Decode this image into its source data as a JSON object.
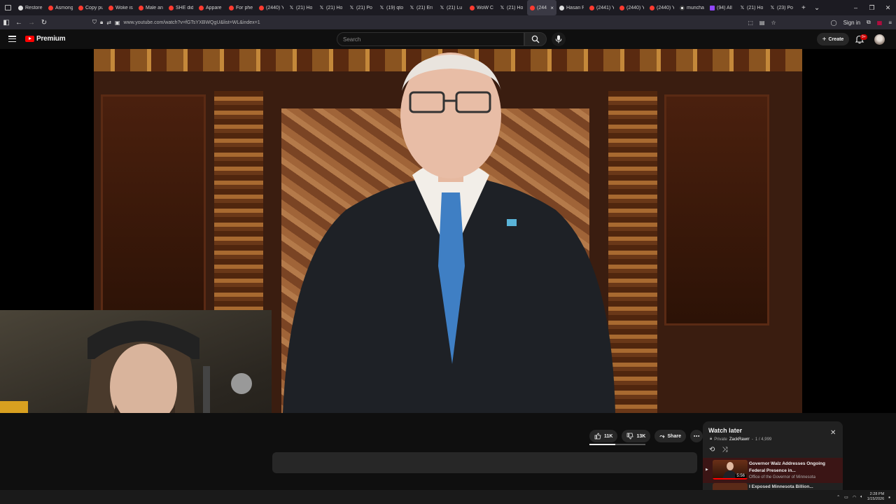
{
  "browser": {
    "tabs": [
      {
        "label": "Restore",
        "icon": "firefox-icon",
        "favicon": "ffx"
      },
      {
        "label": "Asmong",
        "icon": "reddit-icon",
        "favicon": "red"
      },
      {
        "label": "Copy pu",
        "icon": "reddit-icon",
        "favicon": "red"
      },
      {
        "label": "Woke is",
        "icon": "reddit-icon",
        "favicon": "red"
      },
      {
        "label": "Male an",
        "icon": "reddit-icon",
        "favicon": "red"
      },
      {
        "label": "SHE did",
        "icon": "reddit-icon",
        "favicon": "red"
      },
      {
        "label": "Appare",
        "icon": "reddit-icon",
        "favicon": "red"
      },
      {
        "label": "For phe",
        "icon": "reddit-icon",
        "favicon": "red"
      },
      {
        "label": "(2440) Y",
        "icon": "youtube-icon",
        "favicon": "red"
      },
      {
        "label": "(21) Ho",
        "icon": "x-icon",
        "favicon": "x"
      },
      {
        "label": "(21) Ho",
        "icon": "x-icon",
        "favicon": "x"
      },
      {
        "label": "(21) Po",
        "icon": "x-icon",
        "favicon": "x"
      },
      {
        "label": "(19) qto",
        "icon": "x-icon",
        "favicon": "x"
      },
      {
        "label": "(21) Eri",
        "icon": "x-icon",
        "favicon": "x"
      },
      {
        "label": "(21) Lu",
        "icon": "x-icon",
        "favicon": "x"
      },
      {
        "label": "WoW C",
        "icon": "reddit-icon",
        "favicon": "red"
      },
      {
        "label": "(21) Ho",
        "icon": "x-icon",
        "favicon": "x"
      },
      {
        "label": "(244",
        "icon": "youtube-icon",
        "favicon": "red",
        "active": true
      },
      {
        "label": "Hasan P",
        "icon": "site-icon",
        "favicon": "ffx"
      },
      {
        "label": "(2441) Y",
        "icon": "youtube-icon",
        "favicon": "red"
      },
      {
        "label": "(2440) Y",
        "icon": "youtube-icon",
        "favicon": "red"
      },
      {
        "label": "(2440) Y",
        "icon": "youtube-icon",
        "favicon": "red"
      },
      {
        "label": "muncha",
        "icon": "google-icon",
        "favicon": "g"
      },
      {
        "label": "(94) All",
        "icon": "twitch-icon",
        "favicon": "tw"
      },
      {
        "label": "(21) Ho",
        "icon": "x-icon",
        "favicon": "x"
      },
      {
        "label": "(23) Po",
        "icon": "x-icon",
        "favicon": "x"
      }
    ],
    "url": "www.youtube.com/watch?v=fGTsYXBWQgU&list=WL&index=1",
    "sign_in": "Sign in"
  },
  "youtube": {
    "logo_text": "Premium",
    "search_placeholder": "Search",
    "create_label": "Create",
    "notif_badge": "9+"
  },
  "video_actions": {
    "likes": "11K",
    "dislikes": "13K",
    "share": "Share",
    "like_ratio": 0.46
  },
  "watch_later": {
    "title": "Watch later",
    "privacy": "Private",
    "owner": "ZackRawrr",
    "position": "1 / 4,999",
    "current": {
      "title": "Governor Walz Addresses Ongoing Federal Presence in...",
      "channel": "Office of the Governor of Minnesota",
      "duration": "5:56"
    },
    "next_title": "I Exposed Minnesota Billion..."
  },
  "taskbar": {
    "time": "2:28 PM",
    "date": "1/15/2026"
  },
  "colors": {
    "yt_red": "#ff0000",
    "bg": "#0f0f0f",
    "pill": "#272727"
  }
}
